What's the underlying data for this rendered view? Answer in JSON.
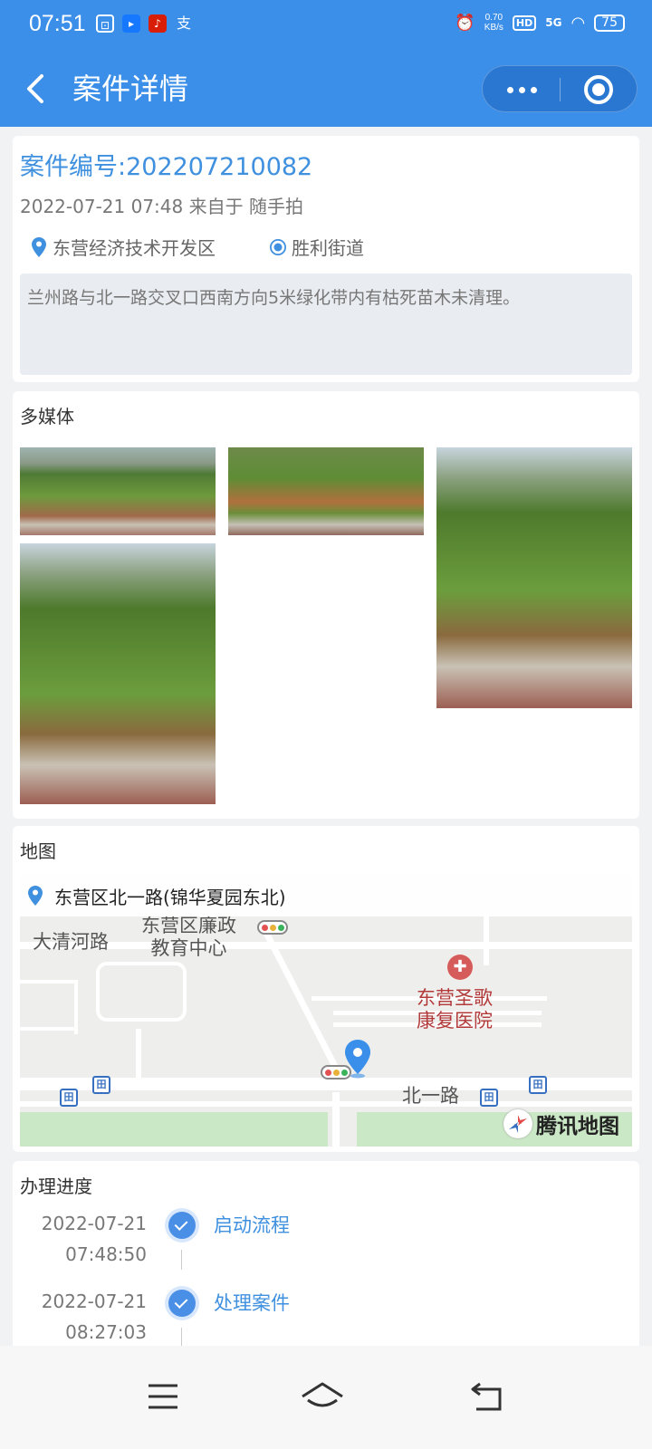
{
  "status_bar": {
    "time": "07:51",
    "app_icons": [
      {
        "name": "app-icon-1",
        "color": "#ffffff",
        "glyph": "⊡"
      },
      {
        "name": "app-icon-2",
        "color": "#1677ff",
        "glyph": "▸"
      },
      {
        "name": "app-icon-3",
        "color": "#d81e06",
        "glyph": "♪"
      },
      {
        "name": "alipay-icon",
        "color": "#3b8fe8",
        "glyph": "支"
      }
    ],
    "speed_value": "0.70",
    "speed_unit": "KB/s",
    "hd": "HD",
    "network": "5G",
    "battery": "75"
  },
  "header": {
    "title": "案件详情"
  },
  "case": {
    "number_label": "案件编号:202207210082",
    "meta": "2022-07-21 07:48 来自于 随手拍",
    "district": "东营经济技术开发区",
    "street": "胜利街道",
    "description": "兰州路与北一路交叉口西南方向5米绿化带内有枯死苗木未清理。"
  },
  "media": {
    "title": "多媒体"
  },
  "map": {
    "title": "地图",
    "address": "东营区北一路(锦华夏园东北)",
    "labels": {
      "road_daqing": "大清河路",
      "poi_edu": "东营区廉政\n教育中心",
      "poi_hosp": "东营圣歌\n康复医院",
      "road_beiyi": "北一路"
    },
    "bus_glyph": "田",
    "hospital_glyph": "✚",
    "brand": "腾讯地图"
  },
  "progress": {
    "title": "办理进度",
    "steps": [
      {
        "date": "2022-07-21",
        "time": "07:48:50",
        "label": "启动流程"
      },
      {
        "date": "2022-07-21",
        "time": "08:27:03",
        "label": "处理案件"
      }
    ]
  },
  "colors": {
    "primary": "#3b8fe8",
    "link": "#3f90df",
    "background": "#f1f2f4"
  }
}
